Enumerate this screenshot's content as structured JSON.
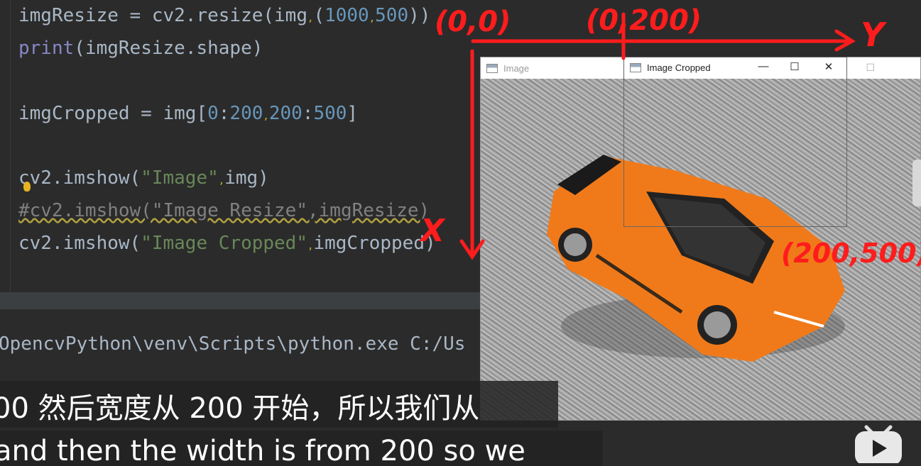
{
  "editor": {
    "lines": [
      {
        "parts": [
          "imgResize = cv2.resize(img",
          ",",
          "(",
          "1000",
          ",",
          "500",
          "))"
        ]
      },
      {
        "fn": "print",
        "rest": "(imgResize.shape)"
      },
      {
        "a": "imgCropped = img[",
        "n1": "0",
        "c1": ":",
        "n2": "200",
        "sep": ",",
        "n3": "200",
        "c2": ":",
        "n4": "500",
        "b": "]"
      },
      {
        "a": "cv2.imshow(",
        "s": "\"Image\"",
        "sep": ",",
        "b": "img)"
      },
      {
        "comment": "#cv2.imshow(\"Image Resize\",imgResize)"
      },
      {
        "a": "cv2.imshow(",
        "s": "\"Image Cropped\"",
        "sep": ",",
        "b": "imgCropped)"
      }
    ]
  },
  "run": {
    "command": "OpencvPython\\venv\\Scripts\\python.exe C:/Us"
  },
  "windows": {
    "image_title": "Image",
    "cropped_title": "Image Cropped",
    "minimize": "—",
    "maximize": "☐",
    "close": "✕"
  },
  "annotations": {
    "origin": "(0,0)",
    "top_point": "(0,200)",
    "y_axis": "Y",
    "x_axis": "X",
    "end_point": "(200,500)"
  },
  "subtitles": {
    "chinese": "00 然后宽度从 200 开始，所以我们从",
    "english": "and then the width is from 200 so we"
  },
  "colors": {
    "annotation": "#ff1c1c",
    "car": "#f07a1a",
    "editor_bg": "#2b2b2b"
  }
}
